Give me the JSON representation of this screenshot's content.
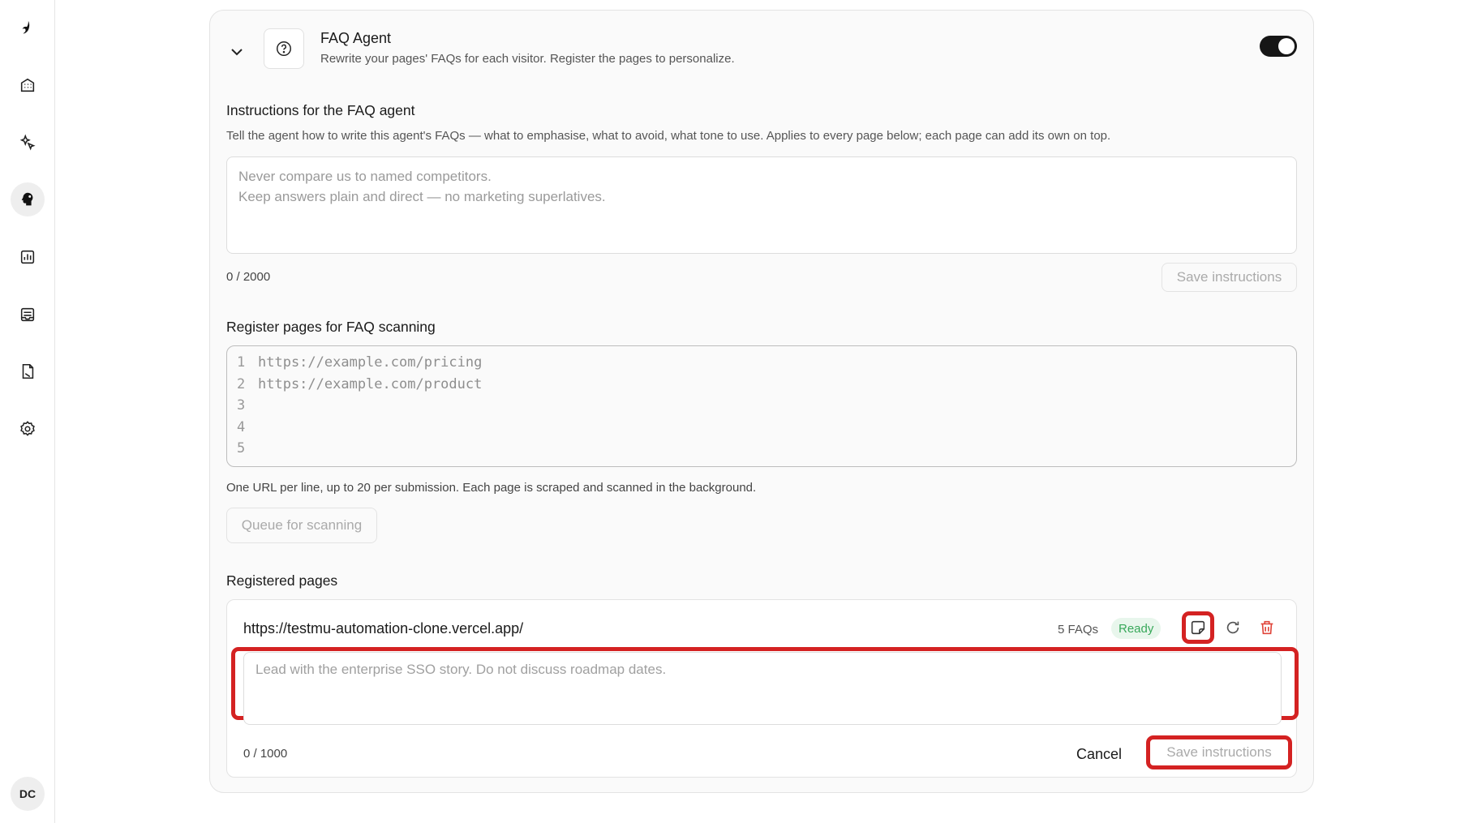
{
  "sidebar": {
    "items": [
      {
        "icon": "logo-icon"
      },
      {
        "icon": "building-icon"
      },
      {
        "icon": "sparkle-pointer-icon"
      },
      {
        "icon": "agent-head-icon",
        "active": true
      },
      {
        "icon": "chart-icon"
      },
      {
        "icon": "inbox-icon"
      },
      {
        "icon": "document-icon"
      },
      {
        "icon": "gear-icon"
      }
    ],
    "avatar": "DC"
  },
  "agent": {
    "title": "FAQ Agent",
    "subtitle": "Rewrite your pages' FAQs for each visitor. Register the pages to personalize.",
    "enabled": true
  },
  "instructions": {
    "title": "Instructions for the FAQ agent",
    "help": "Tell the agent how to write this agent's FAQs — what to emphasise, what to avoid, what tone to use. Applies to every page below; each page can add its own on top.",
    "placeholder": "Never compare us to named competitors.\nKeep answers plain and direct — no marketing superlatives.",
    "counter": "0 / 2000",
    "save_label": "Save instructions"
  },
  "register": {
    "title": "Register pages for FAQ scanning",
    "lines": [
      {
        "num": "1",
        "text": "https://example.com/pricing"
      },
      {
        "num": "2",
        "text": "https://example.com/product"
      },
      {
        "num": "3",
        "text": ""
      },
      {
        "num": "4",
        "text": ""
      },
      {
        "num": "5",
        "text": ""
      }
    ],
    "help": "One URL per line, up to 20 per submission. Each page is scraped and scanned in the background.",
    "queue_label": "Queue for scanning"
  },
  "registered": {
    "title": "Registered pages",
    "pages": [
      {
        "url": "https://testmu-automation-clone.vercel.app/",
        "faq_count": "5 FAQs",
        "status": "Ready",
        "instructions_placeholder": "Lead with the enterprise SSO story. Do not discuss roadmap dates.",
        "counter": "0 / 1000",
        "cancel_label": "Cancel",
        "save_label": "Save instructions"
      }
    ]
  },
  "colors": {
    "highlight": "#d42222",
    "ready_text": "#38a85a",
    "ready_bg": "#e8f6ec",
    "delete": "#e0453a"
  }
}
